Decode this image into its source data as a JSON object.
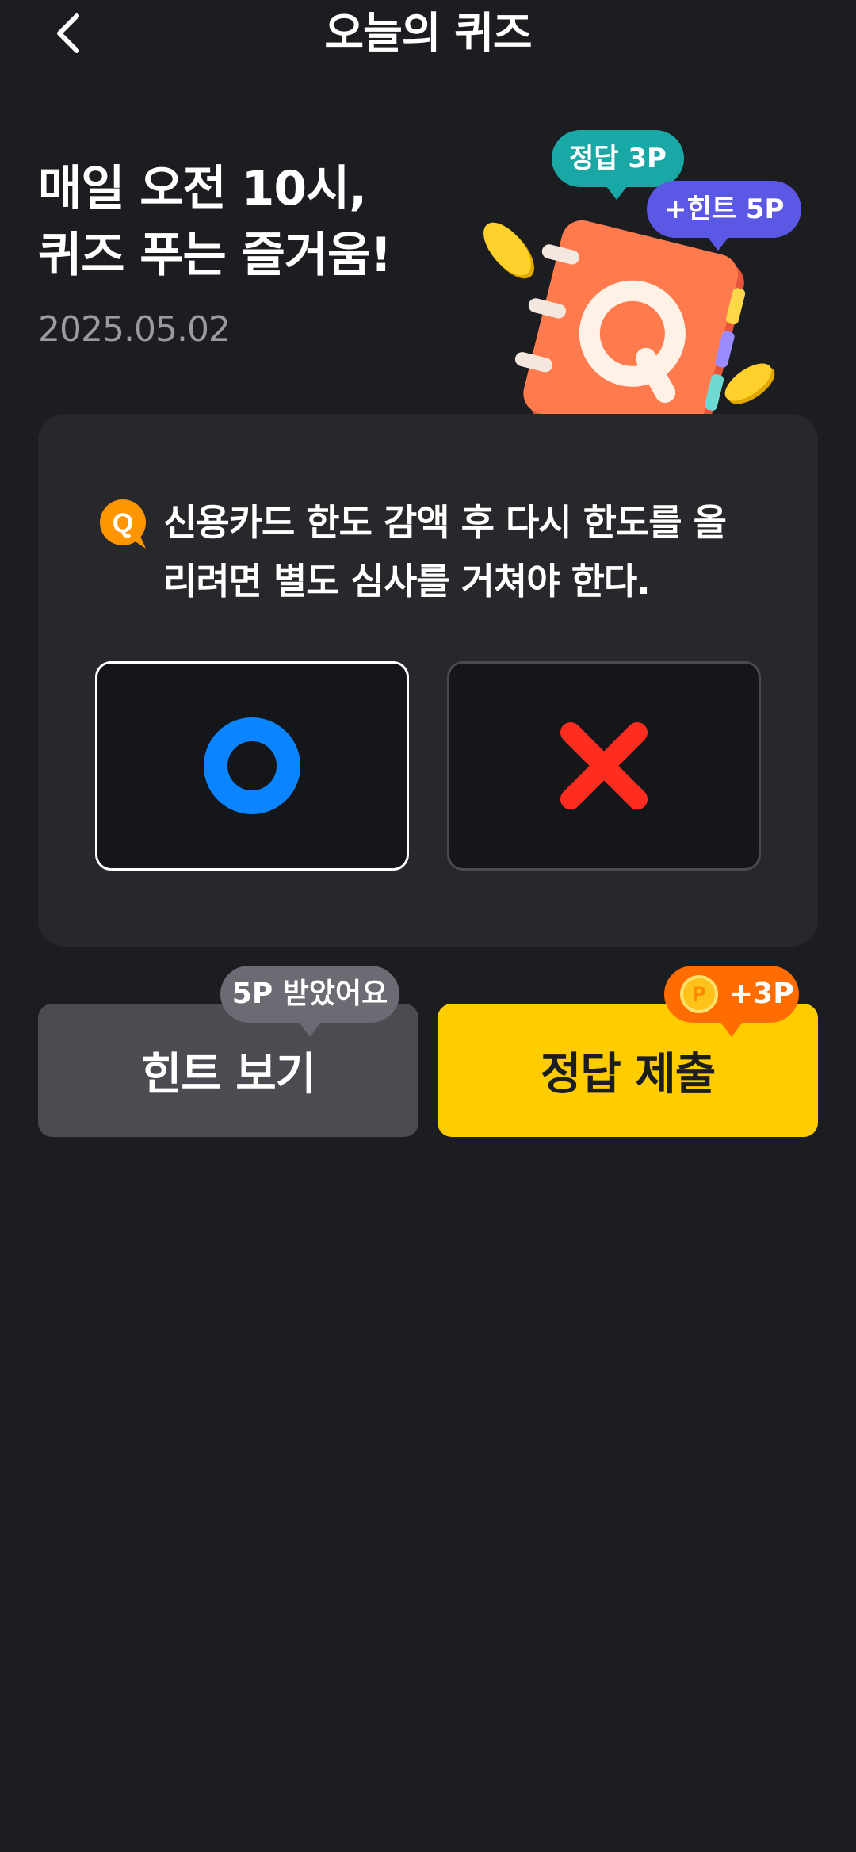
{
  "header": {
    "title": "오늘의 퀴즈"
  },
  "hero": {
    "title_lines": [
      "매일 오전 10시,",
      "퀴즈 푸는 즐거움!"
    ],
    "date": "2025.05.02",
    "bubble_answer": "정답 3P",
    "bubble_hint": "+힌트 5P"
  },
  "quiz": {
    "badge": "Q",
    "question": "신용카드 한도 감액 후 다시 한도를 올리려면 별도 심사를 거쳐야 한다.",
    "choices": [
      {
        "label": "O",
        "color": "#0a84ff",
        "selected": true
      },
      {
        "label": "X",
        "color": "#ff2d20",
        "selected": false
      }
    ]
  },
  "actions": {
    "hint_button": "힌트 보기",
    "hint_tooltip": "5P 받았어요",
    "submit_button": "정답 제출",
    "points_tooltip": "+3P",
    "coin_label": "P"
  },
  "colors": {
    "background": "#1c1d21",
    "card": "#27282c",
    "accent_yellow": "#ffcc00",
    "accent_orange": "#ff6d00",
    "teal": "#19a8a5",
    "purple": "#5b58e6"
  }
}
